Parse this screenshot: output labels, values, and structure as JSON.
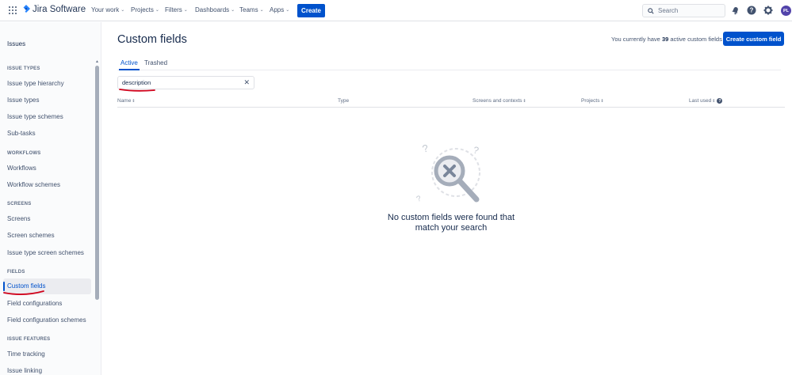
{
  "topnav": {
    "product_name": "Jira Software",
    "items": [
      {
        "label": "Your work"
      },
      {
        "label": "Projects"
      },
      {
        "label": "Filters"
      },
      {
        "label": "Dashboards"
      },
      {
        "label": "Teams"
      },
      {
        "label": "Apps"
      }
    ],
    "create_label": "Create",
    "search_placeholder": "Search",
    "avatar_initials": "PL",
    "icons": [
      "app-switcher-icon",
      "notification-icon",
      "help-icon",
      "settings-icon"
    ]
  },
  "sidebar": {
    "title": "Issues",
    "sections": [
      {
        "heading": "ISSUE TYPES",
        "items": [
          "Issue type hierarchy",
          "Issue types",
          "Issue type schemes",
          "Sub-tasks"
        ]
      },
      {
        "heading": "WORKFLOWS",
        "items": [
          "Workflows",
          "Workflow schemes"
        ]
      },
      {
        "heading": "SCREENS",
        "items": [
          "Screens",
          "Screen schemes",
          "Issue type screen schemes"
        ]
      },
      {
        "heading": "FIELDS",
        "items": [
          "Custom fields",
          "Field configurations",
          "Field configuration schemes"
        ]
      },
      {
        "heading": "ISSUE FEATURES",
        "items": [
          "Time tracking",
          "Issue linking"
        ]
      }
    ],
    "active_item": "Custom fields"
  },
  "main": {
    "title": "Custom fields",
    "count_prefix": "You currently have",
    "count_value": "39",
    "count_suffix": "active custom fields",
    "create_button_label": "Create custom field",
    "tabs": [
      {
        "label": "Active",
        "selected": true
      },
      {
        "label": "Trashed",
        "selected": false
      }
    ],
    "search_value": "description",
    "columns": [
      "Name",
      "Type",
      "Screens and contexts",
      "Projects",
      "Last used"
    ],
    "empty_message_line1": "No custom fields were found that",
    "empty_message_line2": "match your search"
  },
  "colors": {
    "brand_blue": "#0052cc",
    "annotation_red": "#d0021b",
    "sidebar_bg": "#fafbfc"
  }
}
